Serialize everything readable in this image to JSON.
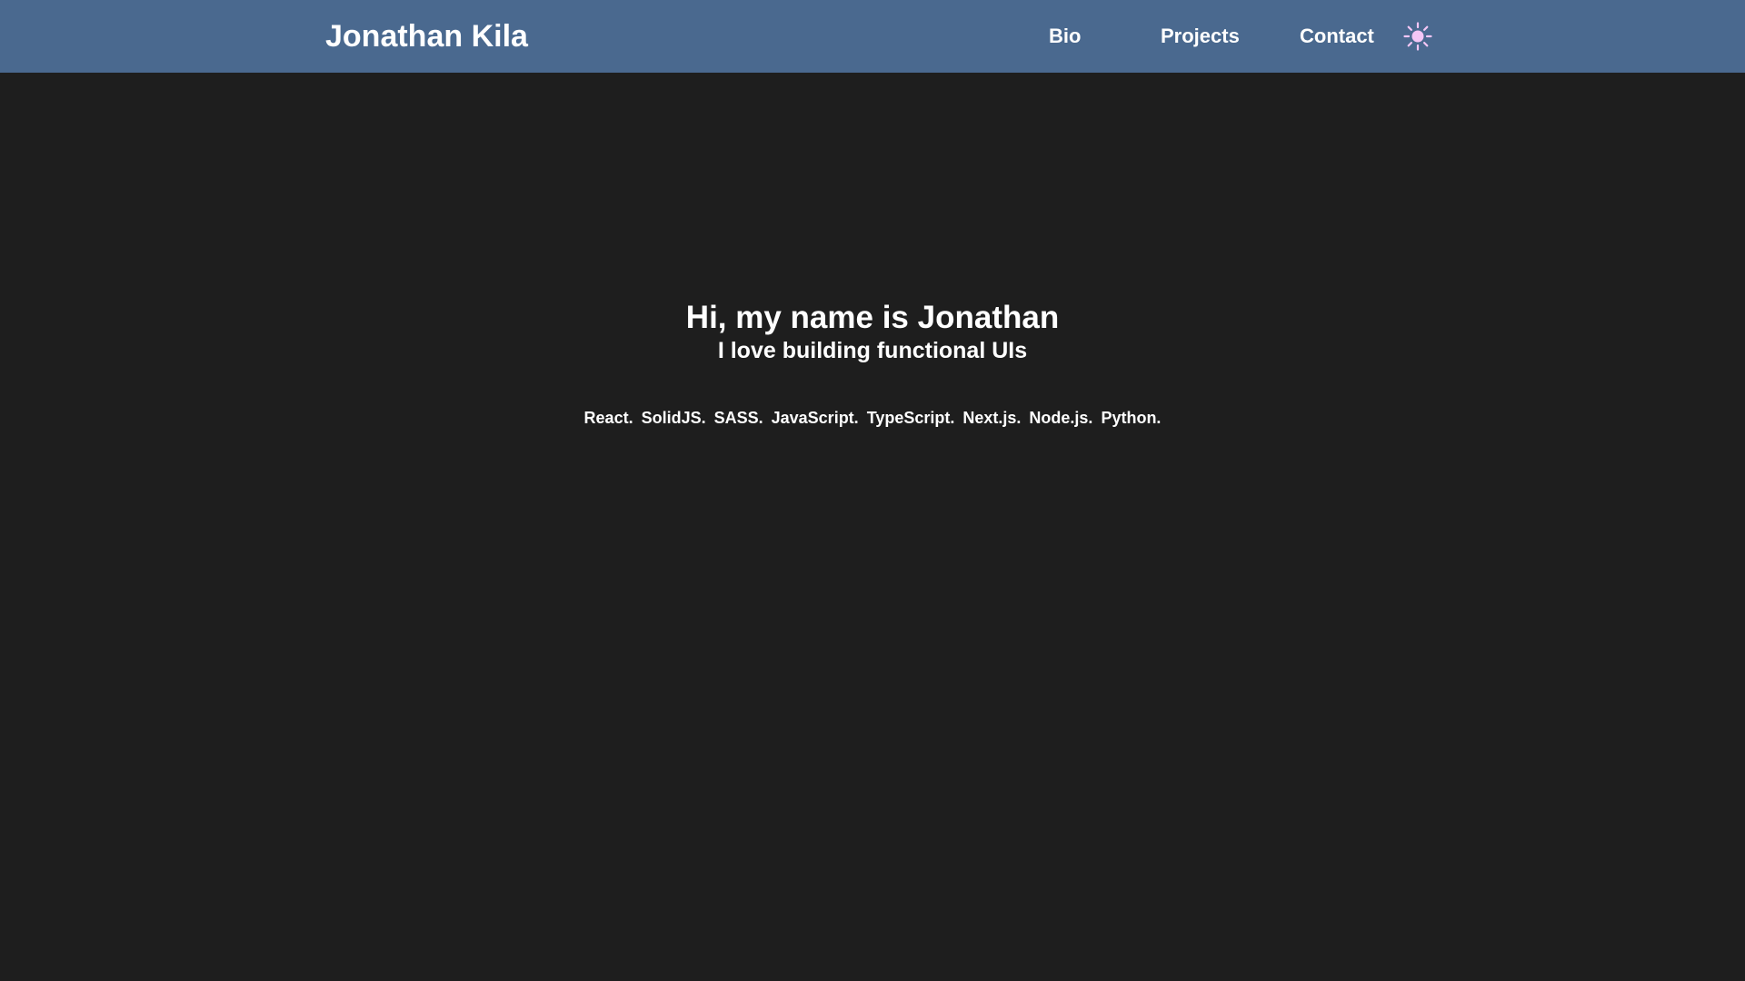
{
  "header": {
    "brand": "Jonathan Kila",
    "nav": {
      "bio": "Bio",
      "projects": "Projects",
      "contact": "Contact"
    },
    "theme_toggle_icon": "sun-icon",
    "colors": {
      "header_bg": "#4a698f",
      "icon": "#f3c6f5"
    }
  },
  "hero": {
    "title": "Hi, my name is Jonathan",
    "subtitle": "I love building functional UIs",
    "skills": [
      "React.",
      "SolidJS.",
      "SASS.",
      "JavaScript.",
      "TypeScript.",
      "Next.js.",
      "Node.js.",
      "Python."
    ]
  },
  "colors": {
    "page_bg": "#1e1e1e",
    "text": "#ffffff"
  }
}
